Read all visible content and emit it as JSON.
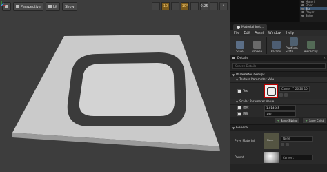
{
  "viewport": {
    "toolbar": [
      {
        "label": "Perspective",
        "icon": "perspective-icon"
      },
      {
        "label": "Lit",
        "icon": "lit-icon"
      },
      {
        "label": "Show",
        "icon": ""
      }
    ],
    "right_controls": [
      "10",
      "10°",
      "0.25",
      "4"
    ]
  },
  "outliner": {
    "rows": [
      "Materi",
      "Floor",
      "Sky",
      "Player",
      "Sphe"
    ]
  },
  "editor": {
    "tab": "Material Inst...",
    "menu": [
      "File",
      "Edit",
      "Asset",
      "Window",
      "Help"
    ],
    "tools": [
      "Save",
      "Browse",
      "Params",
      "Platform Stats",
      "Hierarchy"
    ],
    "details_title": "Details",
    "search_placeholder": "Search Details",
    "section_param_groups": "Parameter Groups",
    "texture_group": "Texture Parameter Valu",
    "tex_label": "Tex",
    "tex_value": "Corner_T_20 20 10",
    "scalar_group": "Scalar Parameter Value",
    "param1_label": "边宽",
    "param1_value": "1.014665",
    "param2_label": "圆角",
    "param2_value": "30.0",
    "save_sibling": "Save Sibling",
    "save_child": "Save Child",
    "section_general": "General",
    "phys_label": "Phys Material",
    "phys_value": "None",
    "phys_thumb": "None",
    "parent_label": "Parent",
    "parent_value": "Corner1"
  }
}
